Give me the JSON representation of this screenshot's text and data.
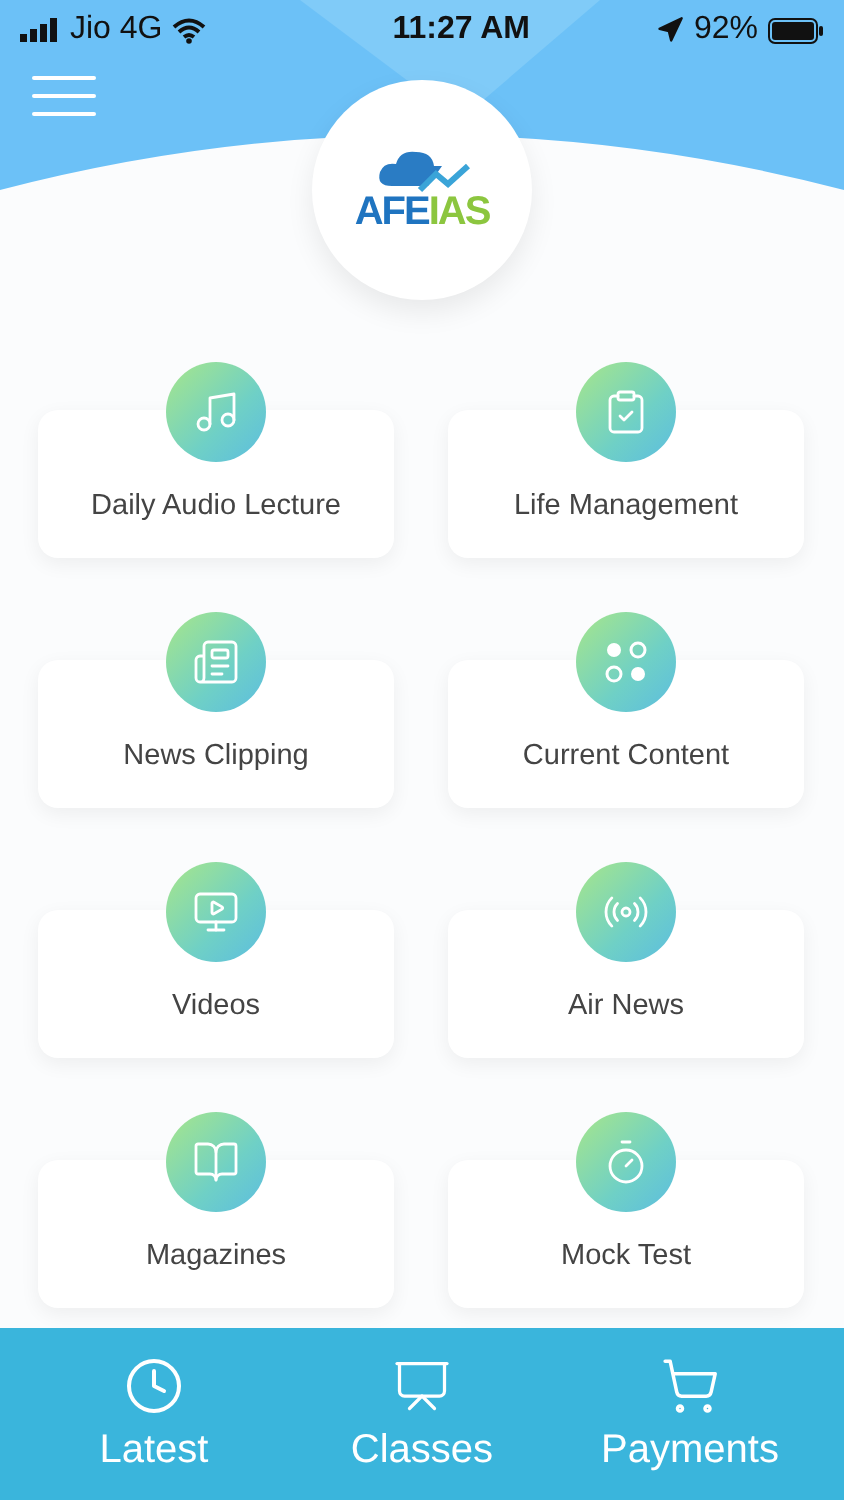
{
  "status_bar": {
    "carrier": "Jio 4G",
    "time": "11:27 AM",
    "battery": "92%"
  },
  "logo": {
    "parts": [
      {
        "text": "AFE",
        "color": "#1f74c0"
      },
      {
        "text": "IAS",
        "color": "#8cc63f"
      }
    ]
  },
  "tiles": [
    {
      "label": "Daily Audio Lecture"
    },
    {
      "label": "Life Management"
    },
    {
      "label": "News Clipping"
    },
    {
      "label": "Current Content"
    },
    {
      "label": "Videos"
    },
    {
      "label": "Air News"
    },
    {
      "label": "Magazines"
    },
    {
      "label": "Mock Test"
    }
  ],
  "bottom_nav": [
    {
      "label": "Latest"
    },
    {
      "label": "Classes"
    },
    {
      "label": "Payments"
    }
  ]
}
